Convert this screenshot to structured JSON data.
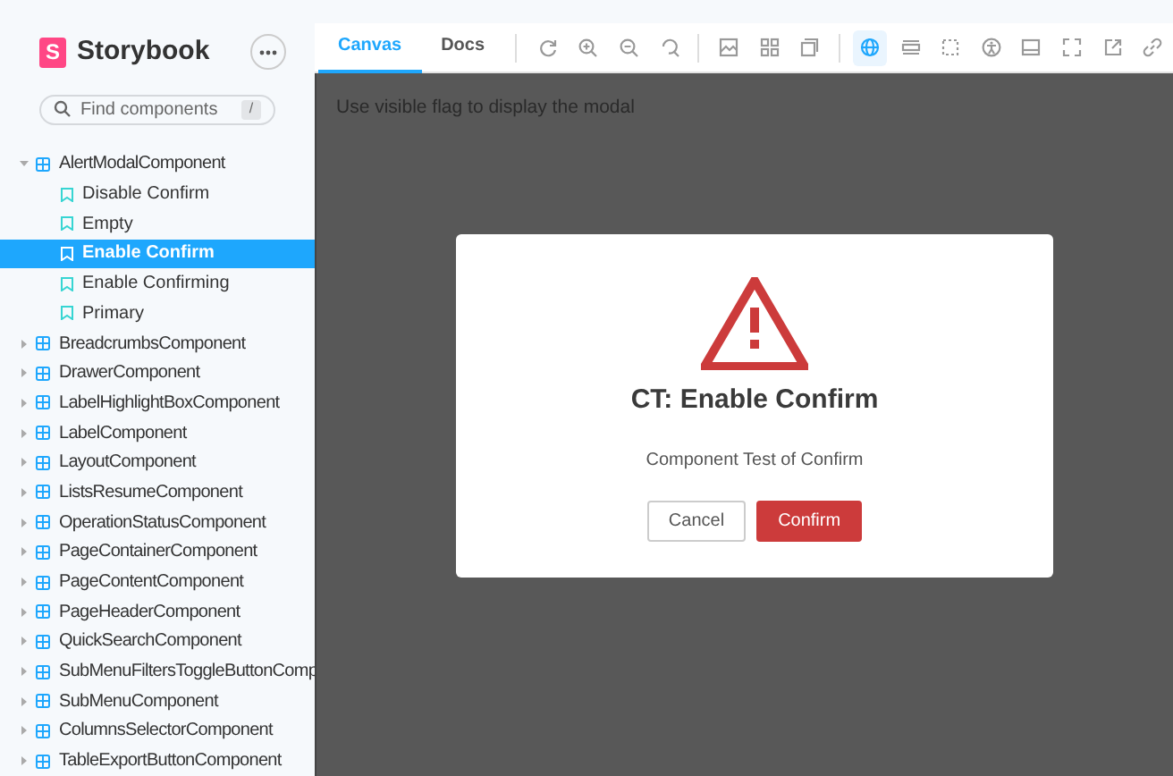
{
  "sidebar": {
    "brand": "Storybook",
    "brand_mark": "S",
    "search": {
      "placeholder": "Find components",
      "shortcut": "/"
    },
    "tree": [
      {
        "label": "AlertModalComponent",
        "expanded": true,
        "children": [
          {
            "label": "Disable Confirm",
            "selected": false
          },
          {
            "label": "Empty",
            "selected": false
          },
          {
            "label": "Enable Confirm",
            "selected": true
          },
          {
            "label": "Enable Confirming",
            "selected": false
          },
          {
            "label": "Primary",
            "selected": false
          }
        ]
      },
      {
        "label": "BreadcrumbsComponent",
        "expanded": false
      },
      {
        "label": "DrawerComponent",
        "expanded": false
      },
      {
        "label": "LabelHighlightBoxComponent",
        "expanded": false
      },
      {
        "label": "LabelComponent",
        "expanded": false
      },
      {
        "label": "LayoutComponent",
        "expanded": false
      },
      {
        "label": "ListsResumeComponent",
        "expanded": false
      },
      {
        "label": "OperationStatusComponent",
        "expanded": false
      },
      {
        "label": "PageContainerComponent",
        "expanded": false
      },
      {
        "label": "PageContentComponent",
        "expanded": false
      },
      {
        "label": "PageHeaderComponent",
        "expanded": false
      },
      {
        "label": "QuickSearchComponent",
        "expanded": false
      },
      {
        "label": "SubMenuFiltersToggleButtonComp",
        "expanded": false
      },
      {
        "label": "SubMenuComponent",
        "expanded": false
      },
      {
        "label": "ColumnsSelectorComponent",
        "expanded": false
      },
      {
        "label": "TableExportButtonComponent",
        "expanded": false
      }
    ]
  },
  "toolbar": {
    "tabs": [
      {
        "label": "Canvas",
        "selected": true
      },
      {
        "label": "Docs",
        "selected": false
      }
    ],
    "tools": [
      {
        "kind": "refresh",
        "selected": false
      },
      {
        "kind": "zoomin",
        "selected": false
      },
      {
        "kind": "zoomout",
        "selected": false
      },
      {
        "kind": "reset",
        "selected": false
      },
      {
        "kind": "sep"
      },
      {
        "kind": "image",
        "selected": false
      },
      {
        "kind": "grid",
        "selected": false
      },
      {
        "kind": "panel",
        "selected": false
      },
      {
        "kind": "sep"
      },
      {
        "kind": "globe",
        "selected": true
      },
      {
        "kind": "ruler",
        "selected": false
      },
      {
        "kind": "outline",
        "selected": false
      },
      {
        "kind": "accessibility",
        "selected": false
      },
      {
        "kind": "gap"
      },
      {
        "kind": "bottompanel",
        "selected": false
      },
      {
        "kind": "fullscreen",
        "selected": false
      },
      {
        "kind": "external",
        "selected": false
      },
      {
        "kind": "link",
        "selected": false
      }
    ]
  },
  "canvas": {
    "note": "Use visible flag to display the modal",
    "modal": {
      "title": "CT: Enable Confirm",
      "message": "Component Test of Confirm",
      "buttons": [
        "Cancel",
        "Confirm"
      ]
    }
  }
}
